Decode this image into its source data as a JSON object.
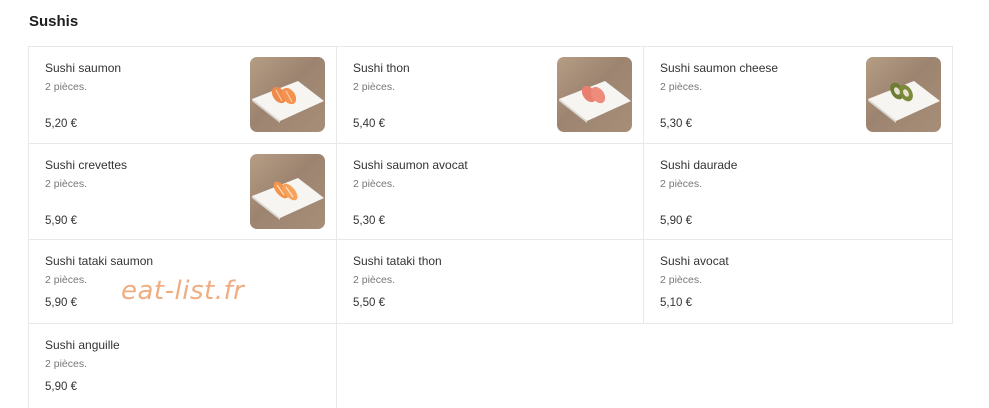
{
  "section": {
    "title": "Sushis"
  },
  "items": [
    {
      "name": "Sushi saumon",
      "desc": "2 pièces.",
      "price": "5,20 €",
      "image": "salmon"
    },
    {
      "name": "Sushi thon",
      "desc": "2 pièces.",
      "price": "5,40 €",
      "image": "tuna"
    },
    {
      "name": "Sushi saumon cheese",
      "desc": "2 pièces.",
      "price": "5,30 €",
      "image": "avocado-roll"
    },
    {
      "name": "Sushi crevettes",
      "desc": "2 pièces.",
      "price": "5,90 €",
      "image": "shrimp"
    },
    {
      "name": "Sushi saumon avocat",
      "desc": "2 pièces.",
      "price": "5,30 €"
    },
    {
      "name": "Sushi daurade",
      "desc": "2 pièces.",
      "price": "5,90 €"
    },
    {
      "name": "Sushi tataki saumon",
      "desc": "2 pièces.",
      "price": "5,90 €"
    },
    {
      "name": "Sushi tataki thon",
      "desc": "2 pièces.",
      "price": "5,50 €"
    },
    {
      "name": "Sushi avocat",
      "desc": "2 pièces.",
      "price": "5,10 €"
    },
    {
      "name": "Sushi anguille",
      "desc": "2 pièces.",
      "price": "5,90 €"
    }
  ],
  "watermark": "eat-list.fr",
  "colors": {
    "border": "#e8e8e8",
    "watermark": "#f0ad82",
    "salmon": "#f08a4b",
    "tuna": "#e9806f",
    "avocado": "#7c8a3c"
  }
}
